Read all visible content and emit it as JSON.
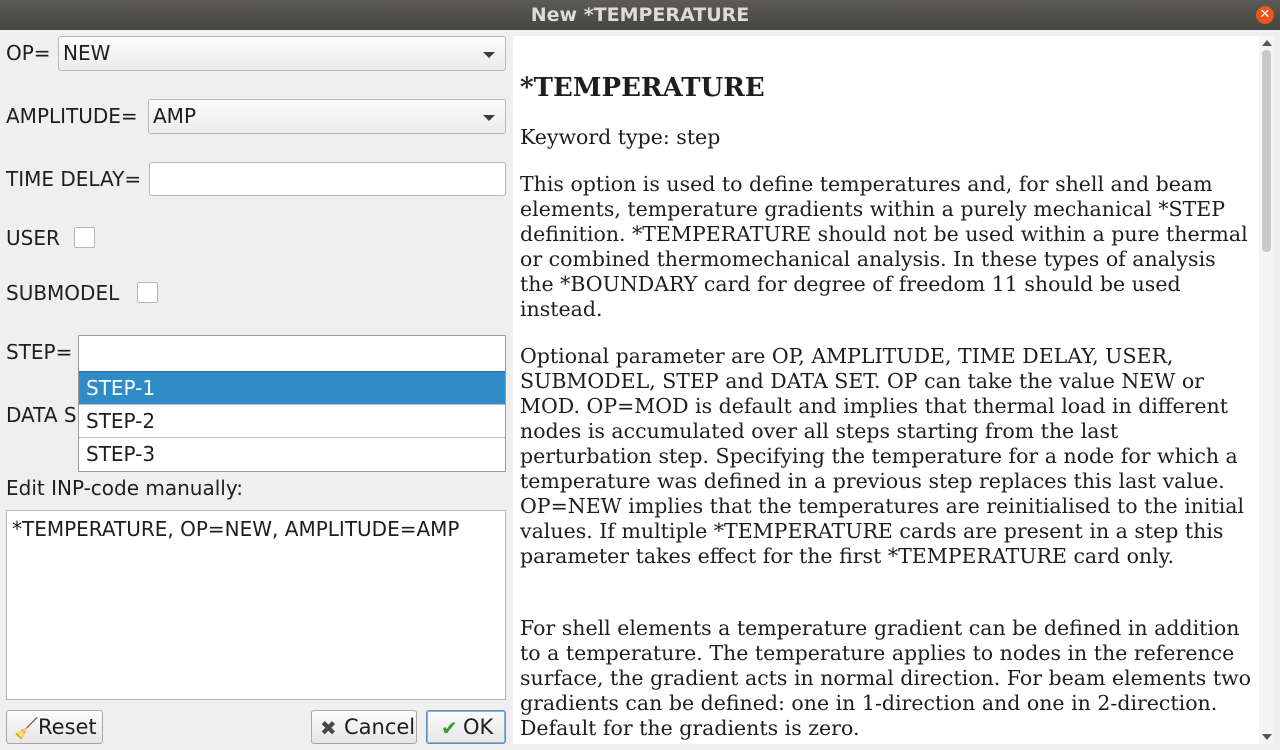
{
  "window": {
    "title": "New *TEMPERATURE"
  },
  "form": {
    "op_label": "OP=",
    "op_value": "NEW",
    "amplitude_label": "AMPLITUDE=",
    "amplitude_value": "AMP",
    "time_delay_label": "TIME DELAY=",
    "time_delay_value": "",
    "user_label": "USER",
    "user_checked": false,
    "submodel_label": "SUBMODEL",
    "submodel_checked": false,
    "step_label": "STEP=",
    "step_value": "",
    "step_options": [
      "STEP-1",
      "STEP-2",
      "STEP-3"
    ],
    "step_highlighted": "STEP-1",
    "data_set_label_visible": "DATA S",
    "edit_label": "Edit INP-code manually:",
    "inp_code": "*TEMPERATURE, OP=NEW, AMPLITUDE=AMP"
  },
  "buttons": {
    "reset": "Reset",
    "cancel": "Cancel",
    "ok": "OK"
  },
  "help": {
    "heading": "*TEMPERATURE",
    "keyword_type": "Keyword type: step",
    "paragraphs": [
      "This option is used to define temperatures and, for shell and beam elements, temperature gradients within a purely mechanical *STEP definition. *TEMPERATURE should not be used within a pure thermal or combined thermomechanical analysis. In these types of analysis the *BOUNDARY card for degree of freedom 11 should be used instead.",
      "Optional parameter are OP, AMPLITUDE, TIME DELAY, USER, SUBMODEL, STEP and DATA SET. OP can take the value NEW or MOD. OP=MOD is default and implies that thermal load in different nodes is accumulated over all steps starting from the last perturbation step. Specifying the temperature for a node for which a temperature was defined in a previous step replaces this last value. OP=NEW implies that the temperatures are reinitialised to the initial values. If multiple *TEMPERATURE cards are present in a step this parameter takes effect for the first *TEMPERATURE card only.",
      "For shell elements a temperature gradient can be defined in addition to a temperature. The temperature applies to nodes in the reference surface, the gradient acts in normal direction. For beam elements two gradients can be defined: one in 1-direction and one in 2-direction. Default for the gradients is zero."
    ]
  },
  "colors": {
    "selection": "#308cc6",
    "titlebar": "#4f4e49",
    "close": "#e9541f"
  },
  "icons": {
    "reset": "broom-icon",
    "cancel": "x-icon",
    "ok": "checkmark-icon"
  }
}
